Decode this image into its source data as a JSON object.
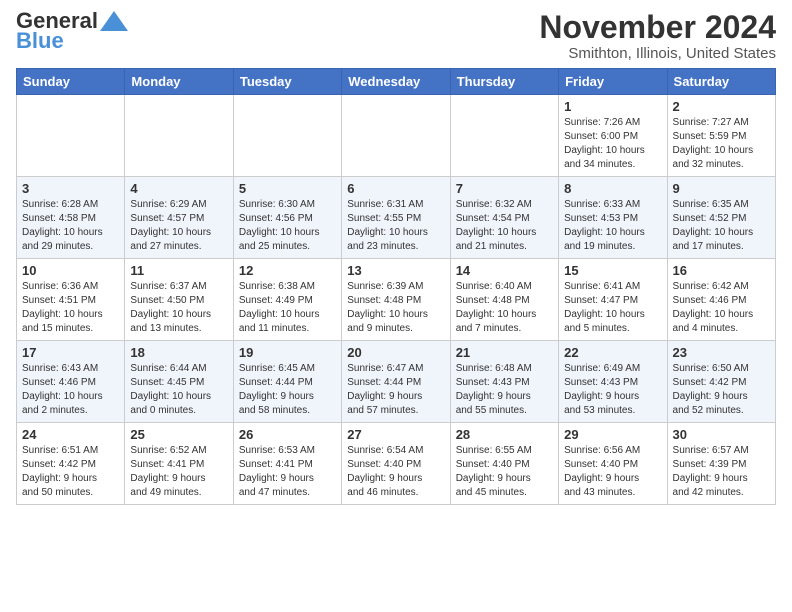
{
  "header": {
    "logo_line1": "General",
    "logo_line2": "Blue",
    "title": "November 2024",
    "subtitle": "Smithton, Illinois, United States"
  },
  "weekdays": [
    "Sunday",
    "Monday",
    "Tuesday",
    "Wednesday",
    "Thursday",
    "Friday",
    "Saturday"
  ],
  "weeks": [
    [
      {
        "day": "",
        "info": ""
      },
      {
        "day": "",
        "info": ""
      },
      {
        "day": "",
        "info": ""
      },
      {
        "day": "",
        "info": ""
      },
      {
        "day": "",
        "info": ""
      },
      {
        "day": "1",
        "info": "Sunrise: 7:26 AM\nSunset: 6:00 PM\nDaylight: 10 hours\nand 34 minutes."
      },
      {
        "day": "2",
        "info": "Sunrise: 7:27 AM\nSunset: 5:59 PM\nDaylight: 10 hours\nand 32 minutes."
      }
    ],
    [
      {
        "day": "3",
        "info": "Sunrise: 6:28 AM\nSunset: 4:58 PM\nDaylight: 10 hours\nand 29 minutes."
      },
      {
        "day": "4",
        "info": "Sunrise: 6:29 AM\nSunset: 4:57 PM\nDaylight: 10 hours\nand 27 minutes."
      },
      {
        "day": "5",
        "info": "Sunrise: 6:30 AM\nSunset: 4:56 PM\nDaylight: 10 hours\nand 25 minutes."
      },
      {
        "day": "6",
        "info": "Sunrise: 6:31 AM\nSunset: 4:55 PM\nDaylight: 10 hours\nand 23 minutes."
      },
      {
        "day": "7",
        "info": "Sunrise: 6:32 AM\nSunset: 4:54 PM\nDaylight: 10 hours\nand 21 minutes."
      },
      {
        "day": "8",
        "info": "Sunrise: 6:33 AM\nSunset: 4:53 PM\nDaylight: 10 hours\nand 19 minutes."
      },
      {
        "day": "9",
        "info": "Sunrise: 6:35 AM\nSunset: 4:52 PM\nDaylight: 10 hours\nand 17 minutes."
      }
    ],
    [
      {
        "day": "10",
        "info": "Sunrise: 6:36 AM\nSunset: 4:51 PM\nDaylight: 10 hours\nand 15 minutes."
      },
      {
        "day": "11",
        "info": "Sunrise: 6:37 AM\nSunset: 4:50 PM\nDaylight: 10 hours\nand 13 minutes."
      },
      {
        "day": "12",
        "info": "Sunrise: 6:38 AM\nSunset: 4:49 PM\nDaylight: 10 hours\nand 11 minutes."
      },
      {
        "day": "13",
        "info": "Sunrise: 6:39 AM\nSunset: 4:48 PM\nDaylight: 10 hours\nand 9 minutes."
      },
      {
        "day": "14",
        "info": "Sunrise: 6:40 AM\nSunset: 4:48 PM\nDaylight: 10 hours\nand 7 minutes."
      },
      {
        "day": "15",
        "info": "Sunrise: 6:41 AM\nSunset: 4:47 PM\nDaylight: 10 hours\nand 5 minutes."
      },
      {
        "day": "16",
        "info": "Sunrise: 6:42 AM\nSunset: 4:46 PM\nDaylight: 10 hours\nand 4 minutes."
      }
    ],
    [
      {
        "day": "17",
        "info": "Sunrise: 6:43 AM\nSunset: 4:46 PM\nDaylight: 10 hours\nand 2 minutes."
      },
      {
        "day": "18",
        "info": "Sunrise: 6:44 AM\nSunset: 4:45 PM\nDaylight: 10 hours\nand 0 minutes."
      },
      {
        "day": "19",
        "info": "Sunrise: 6:45 AM\nSunset: 4:44 PM\nDaylight: 9 hours\nand 58 minutes."
      },
      {
        "day": "20",
        "info": "Sunrise: 6:47 AM\nSunset: 4:44 PM\nDaylight: 9 hours\nand 57 minutes."
      },
      {
        "day": "21",
        "info": "Sunrise: 6:48 AM\nSunset: 4:43 PM\nDaylight: 9 hours\nand 55 minutes."
      },
      {
        "day": "22",
        "info": "Sunrise: 6:49 AM\nSunset: 4:43 PM\nDaylight: 9 hours\nand 53 minutes."
      },
      {
        "day": "23",
        "info": "Sunrise: 6:50 AM\nSunset: 4:42 PM\nDaylight: 9 hours\nand 52 minutes."
      }
    ],
    [
      {
        "day": "24",
        "info": "Sunrise: 6:51 AM\nSunset: 4:42 PM\nDaylight: 9 hours\nand 50 minutes."
      },
      {
        "day": "25",
        "info": "Sunrise: 6:52 AM\nSunset: 4:41 PM\nDaylight: 9 hours\nand 49 minutes."
      },
      {
        "day": "26",
        "info": "Sunrise: 6:53 AM\nSunset: 4:41 PM\nDaylight: 9 hours\nand 47 minutes."
      },
      {
        "day": "27",
        "info": "Sunrise: 6:54 AM\nSunset: 4:40 PM\nDaylight: 9 hours\nand 46 minutes."
      },
      {
        "day": "28",
        "info": "Sunrise: 6:55 AM\nSunset: 4:40 PM\nDaylight: 9 hours\nand 45 minutes."
      },
      {
        "day": "29",
        "info": "Sunrise: 6:56 AM\nSunset: 4:40 PM\nDaylight: 9 hours\nand 43 minutes."
      },
      {
        "day": "30",
        "info": "Sunrise: 6:57 AM\nSunset: 4:39 PM\nDaylight: 9 hours\nand 42 minutes."
      }
    ]
  ]
}
